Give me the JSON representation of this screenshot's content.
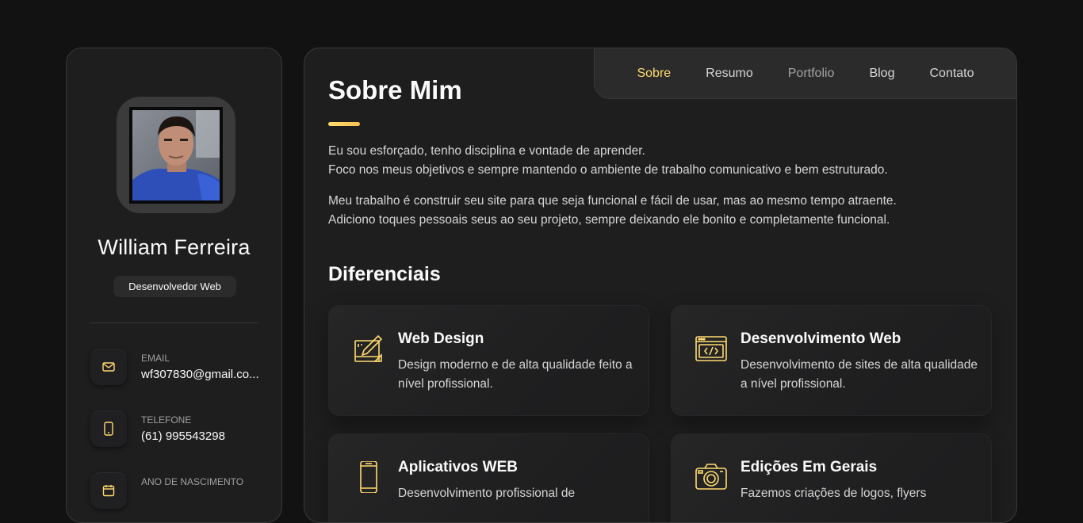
{
  "profile": {
    "name": "William Ferreira",
    "title": "Desenvolvedor Web",
    "contacts": [
      {
        "label": "EMAIL",
        "value": "wf307830@gmail.co...",
        "icon": "mail-icon"
      },
      {
        "label": "TELEFONE",
        "value": "(61) 995543298",
        "icon": "phone-icon"
      },
      {
        "label": "ANO DE NASCIMENTO",
        "value": "",
        "icon": "calendar-icon"
      }
    ]
  },
  "nav": {
    "items": [
      {
        "label": "Sobre",
        "state": "active"
      },
      {
        "label": "Resumo",
        "state": "normal"
      },
      {
        "label": "Portfolio",
        "state": "muted"
      },
      {
        "label": "Blog",
        "state": "normal"
      },
      {
        "label": "Contato",
        "state": "normal"
      }
    ]
  },
  "about": {
    "title": "Sobre Mim",
    "paragraphs": [
      [
        "Eu sou esforçado, tenho disciplina e vontade de aprender.",
        "Foco nos meus objetivos e sempre mantendo o ambiente de trabalho comunicativo e bem estruturado."
      ],
      [
        "Meu trabalho é construir seu site para que seja funcional e fácil de usar, mas ao mesmo tempo atraente.",
        "Adiciono toques pessoais seus ao seu projeto, sempre deixando ele bonito e completamente funcional."
      ]
    ]
  },
  "services": {
    "title": "Diferenciais",
    "items": [
      {
        "title": "Web Design",
        "desc": "Design moderno e de alta qualidade feito a nível profissional.",
        "icon": "design-icon"
      },
      {
        "title": "Desenvolvimento Web",
        "desc": "Desenvolvimento de sites de alta qualidade a nível profissional.",
        "icon": "code-window-icon"
      },
      {
        "title": "Aplicativos WEB",
        "desc": "Desenvolvimento profissional de",
        "icon": "smartphone-icon"
      },
      {
        "title": "Edições Em Gerais",
        "desc": "Fazemos criações de logos, flyers",
        "icon": "camera-icon"
      }
    ]
  },
  "colors": {
    "accent": "#ffdb70",
    "background": "#121212",
    "panel": "#1e1e1f"
  }
}
